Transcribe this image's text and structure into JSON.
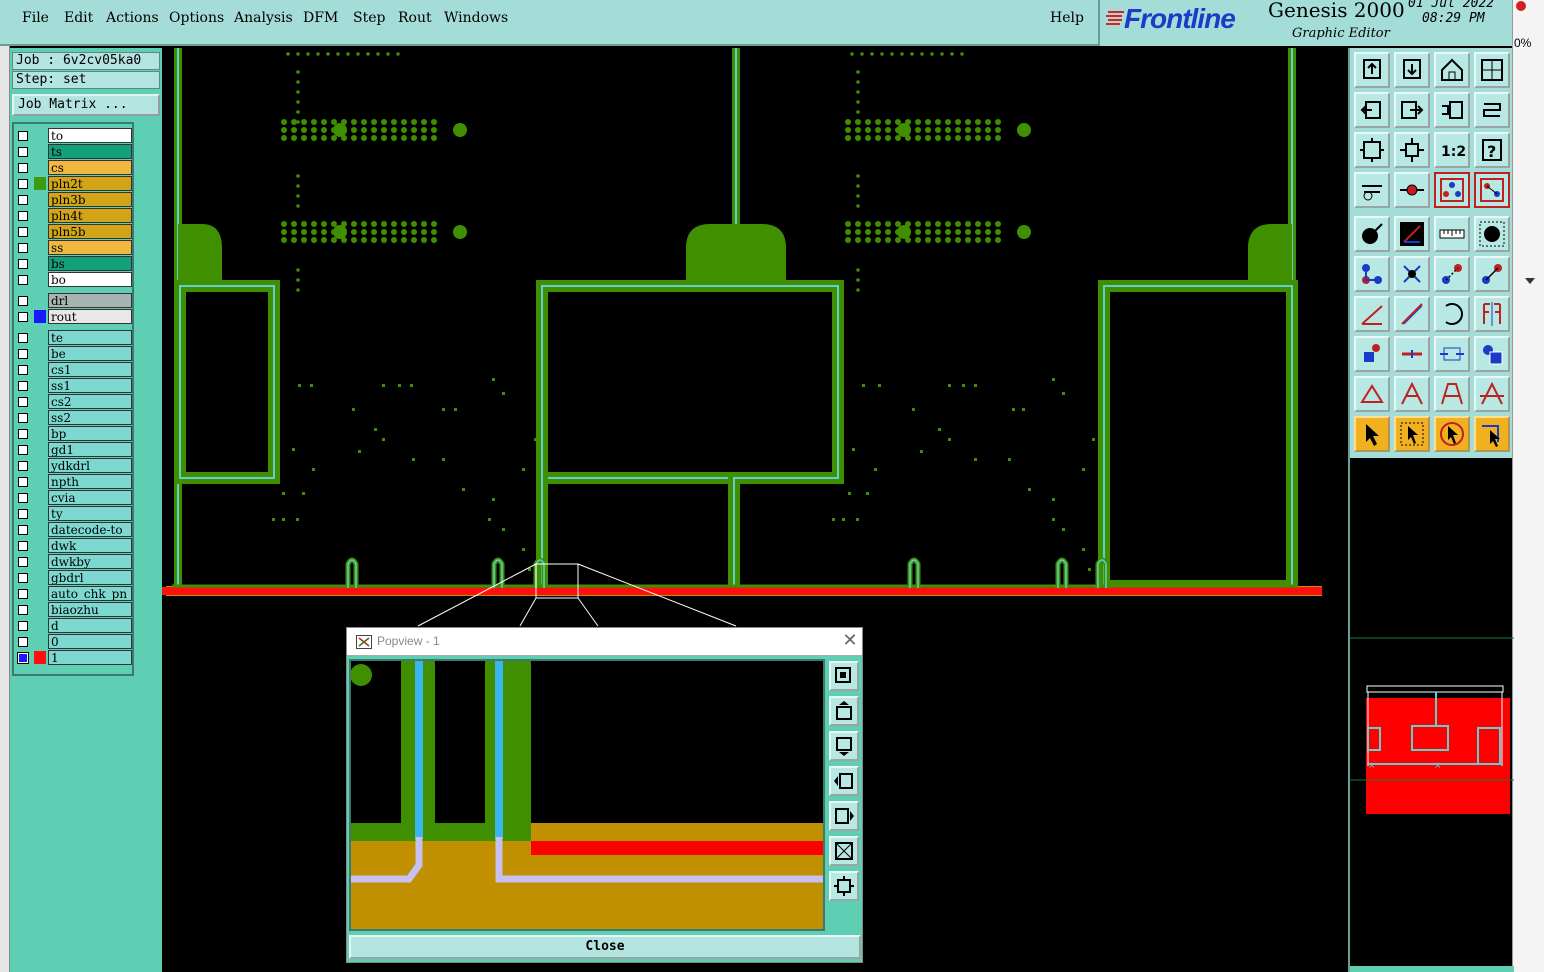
{
  "menu": {
    "items": [
      "File",
      "Edit",
      "Actions",
      "Options",
      "Analysis",
      "DFM",
      "Step",
      "Rout",
      "Windows"
    ],
    "help": "Help"
  },
  "brand": {
    "logo": "Frontline",
    "product": "Genesis 2000",
    "subtitle": "Graphic Editor",
    "date": "01 Jul 2022",
    "time": "08:29 PM"
  },
  "edge": {
    "percent": "0%"
  },
  "job": {
    "job_line": "Job : 6v2cv05ka0",
    "step_line": "Step: set",
    "matrix_button": "Job Matrix ..."
  },
  "layers": [
    {
      "name": "to",
      "color": "#ffffff",
      "swatch": ""
    },
    {
      "name": "ts",
      "color": "#14a07a",
      "swatch": ""
    },
    {
      "name": "cs",
      "color": "#f0b840",
      "swatch": ""
    },
    {
      "name": "pln2t",
      "color": "#d4a418",
      "swatch": "#3a9a10"
    },
    {
      "name": "pln3b",
      "color": "#d4a418",
      "swatch": ""
    },
    {
      "name": "pln4t",
      "color": "#d4a418",
      "swatch": ""
    },
    {
      "name": "pln5b",
      "color": "#d4a418",
      "swatch": ""
    },
    {
      "name": "ss",
      "color": "#f0b840",
      "swatch": ""
    },
    {
      "name": "bs",
      "color": "#14a07a",
      "swatch": ""
    },
    {
      "name": "bo",
      "color": "#ffffff",
      "swatch": ""
    },
    {
      "name": "drl",
      "color": "#a8b4b4",
      "swatch": ""
    },
    {
      "name": "rout",
      "color": "#e8e8e8",
      "swatch": "#1a1aff"
    },
    {
      "name": "te",
      "color": "#7cd8d0",
      "swatch": ""
    },
    {
      "name": "be",
      "color": "#7cd8d0",
      "swatch": ""
    },
    {
      "name": "cs1",
      "color": "#7cd8d0",
      "swatch": ""
    },
    {
      "name": "ss1",
      "color": "#7cd8d0",
      "swatch": ""
    },
    {
      "name": "cs2",
      "color": "#7cd8d0",
      "swatch": ""
    },
    {
      "name": "ss2",
      "color": "#7cd8d0",
      "swatch": ""
    },
    {
      "name": "bp",
      "color": "#7cd8d0",
      "swatch": ""
    },
    {
      "name": "gd1",
      "color": "#7cd8d0",
      "swatch": ""
    },
    {
      "name": "ydkdrl",
      "color": "#7cd8d0",
      "swatch": ""
    },
    {
      "name": "npth",
      "color": "#7cd8d0",
      "swatch": ""
    },
    {
      "name": "cvia",
      "color": "#7cd8d0",
      "swatch": ""
    },
    {
      "name": "ty",
      "color": "#7cd8d0",
      "swatch": ""
    },
    {
      "name": "datecode-to",
      "color": "#7cd8d0",
      "swatch": ""
    },
    {
      "name": "dwk",
      "color": "#7cd8d0",
      "swatch": ""
    },
    {
      "name": "dwkby",
      "color": "#7cd8d0",
      "swatch": ""
    },
    {
      "name": "gbdrl",
      "color": "#7cd8d0",
      "swatch": ""
    },
    {
      "name": "auto_chk_pn",
      "color": "#7cd8d0",
      "swatch": ""
    },
    {
      "name": "biaozhu",
      "color": "#7cd8d0",
      "swatch": ""
    },
    {
      "name": "d",
      "color": "#7cd8d0",
      "swatch": ""
    },
    {
      "name": "0",
      "color": "#7cd8d0",
      "swatch": ""
    },
    {
      "name": "1",
      "color": "#7cd8d0",
      "swatch": "#ff1010",
      "checked": true
    }
  ],
  "toolbox": {
    "tools": [
      "zoom-home-up-icon",
      "zoom-home-down-icon",
      "home-icon",
      "fit-window-icon",
      "pan-left-icon",
      "pan-right-icon",
      "undo-zoom-icon",
      "redraw-icon",
      "zoom-fit-icon",
      "zoom-center-icon",
      "scale-1to2-icon",
      "help-query-icon",
      "snap-settings-icon",
      "measure-key-icon",
      "layer-highlight-icon",
      "layer-compare-icon",
      "add-pad-icon",
      "add-line-icon",
      "ruler-icon",
      "feature-dot-icon",
      "connect-icon",
      "cross-icon",
      "move-icon",
      "copy-icon",
      "angle-line-icon",
      "slash-line-icon",
      "arc-icon",
      "mirror-icon",
      "resize-icon",
      "split-icon",
      "stretch-icon",
      "group-icon",
      "triangle-icon",
      "a-shape-icon",
      "a-wide-icon",
      "a-cross-icon",
      "select-arrow-icon",
      "select-box-icon",
      "select-circle-icon",
      "select-path-icon"
    ]
  },
  "popview": {
    "title": "Popview - 1",
    "close_label": "Close",
    "tools": [
      "zoom-in-icon",
      "pan-up-icon",
      "pan-down-icon",
      "pan-left-icon",
      "pan-right-icon",
      "zoom-out-icon",
      "fit-icon"
    ]
  }
}
